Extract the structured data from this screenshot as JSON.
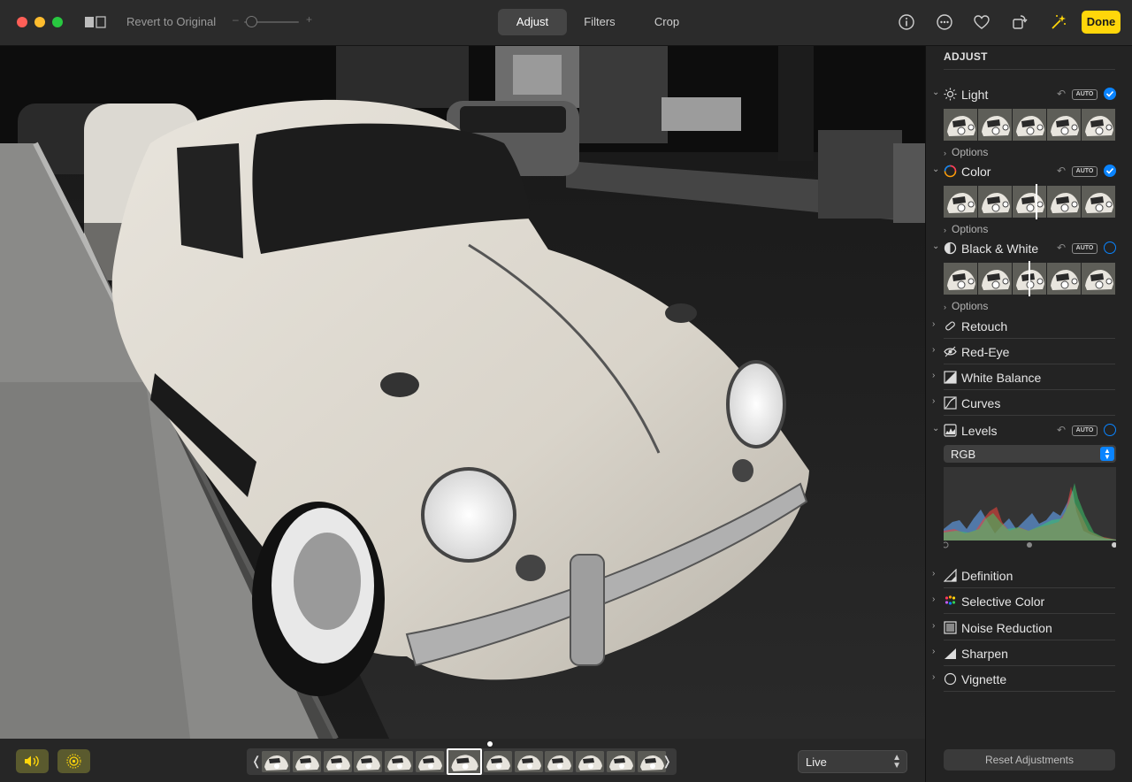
{
  "toolbar": {
    "revert_label": "Revert to Original",
    "slider_minus": "–",
    "slider_plus": "+",
    "tabs": [
      {
        "label": "Adjust",
        "selected": true
      },
      {
        "label": "Filters",
        "selected": false
      },
      {
        "label": "Crop",
        "selected": false
      }
    ],
    "icons": [
      "compare-icon",
      "info-icon",
      "more-icon",
      "favorite-heart-icon",
      "rotate-icon",
      "auto-enhance-icon"
    ],
    "done_label": "Done",
    "accent_color": "#ffd60a"
  },
  "sidebar": {
    "title": "ADJUST",
    "auto_badge": "AUTO",
    "options_label": "Options",
    "accent_color": "#0a84ff",
    "expanded_sections": [
      {
        "name": "Light",
        "icon": "sun-icon",
        "checked": true
      },
      {
        "name": "Color",
        "icon": "color-circle-icon",
        "checked": true
      },
      {
        "name": "Black & White",
        "icon": "half-circle-icon",
        "checked": false
      }
    ],
    "levels": {
      "name": "Levels",
      "icon": "levels-icon",
      "checked": false,
      "channel": "RGB"
    },
    "collapsed_top": [
      {
        "name": "Retouch",
        "icon": "bandage-icon"
      },
      {
        "name": "Red-Eye",
        "icon": "eye-icon"
      },
      {
        "name": "White Balance",
        "icon": "white-balance-icon"
      },
      {
        "name": "Curves",
        "icon": "curves-icon"
      }
    ],
    "collapsed_bottom": [
      {
        "name": "Definition",
        "icon": "definition-icon"
      },
      {
        "name": "Selective Color",
        "icon": "selective-color-icon"
      },
      {
        "name": "Noise Reduction",
        "icon": "noise-reduction-icon"
      },
      {
        "name": "Sharpen",
        "icon": "sharpen-icon"
      },
      {
        "name": "Vignette",
        "icon": "vignette-icon"
      }
    ],
    "reset_label": "Reset Adjustments"
  },
  "bottom": {
    "sound_icon": "speaker-icon",
    "live_icon": "live-photo-icon",
    "filmstrip_frames": 13,
    "selected_frame": 7,
    "live_select_value": "Live"
  }
}
